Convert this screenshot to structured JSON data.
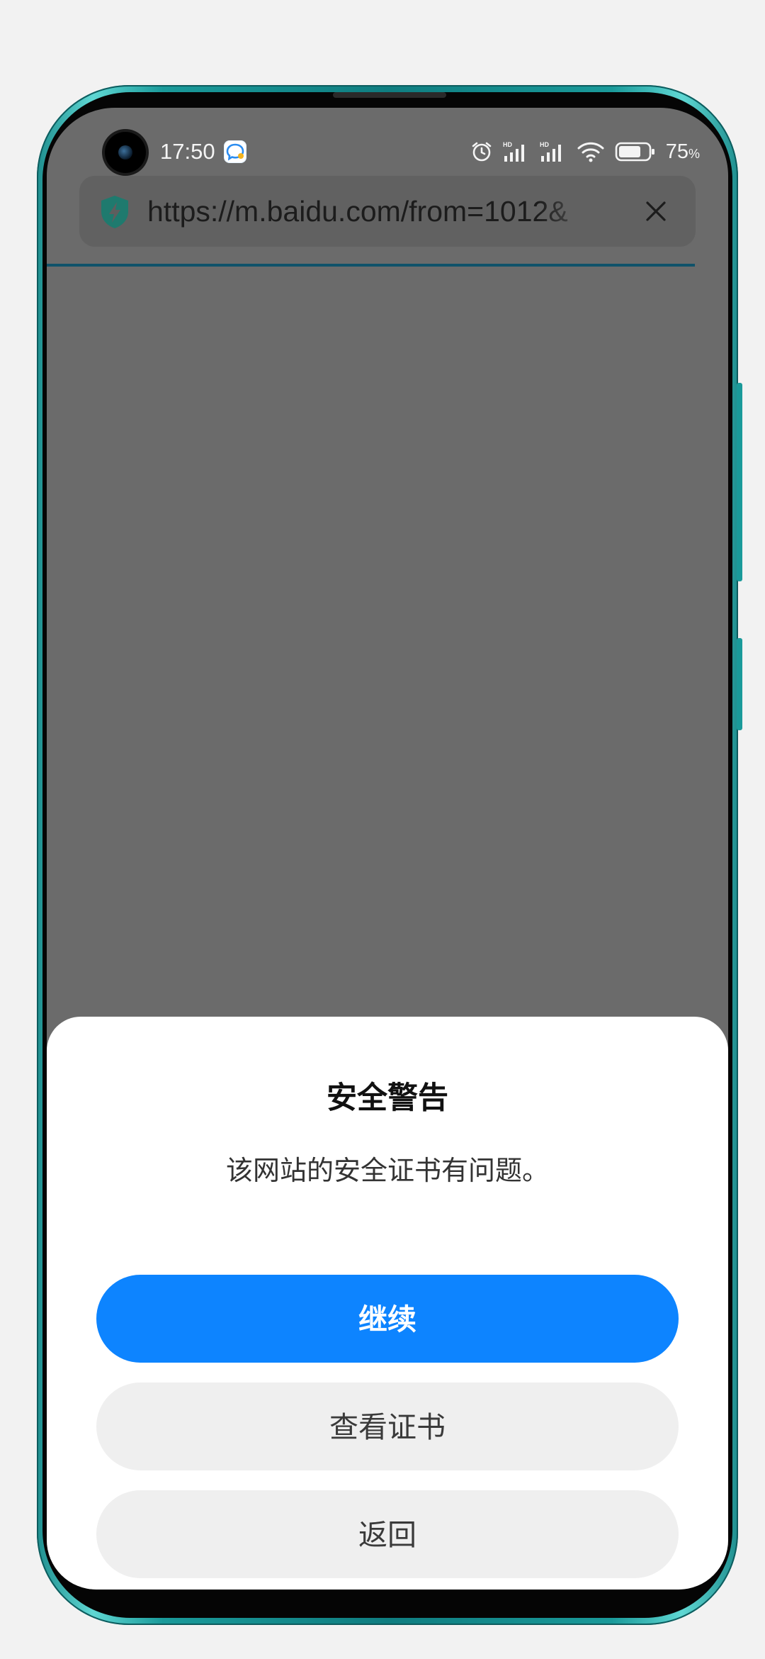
{
  "status_bar": {
    "time": "17:50",
    "battery_percent_value": "75",
    "battery_percent_unit": "%",
    "battery_level": 0.75,
    "icons": [
      "front-camera-icon",
      "messenger-notification-icon",
      "alarm-icon",
      "hd-signal-icon",
      "hd-signal-icon",
      "wifi-icon",
      "battery-icon"
    ]
  },
  "browser": {
    "url": "https://m.baidu.com/from=1012&",
    "secure_icon": "shield-bolt-icon",
    "close_icon": "close-icon",
    "accent_color": "#1f7a6e"
  },
  "dialog": {
    "title": "安全警告",
    "message": "该网站的安全证书有问题。",
    "continue_label": "继续",
    "view_cert_label": "查看证书",
    "back_label": "返回",
    "primary_color": "#0d84ff"
  }
}
